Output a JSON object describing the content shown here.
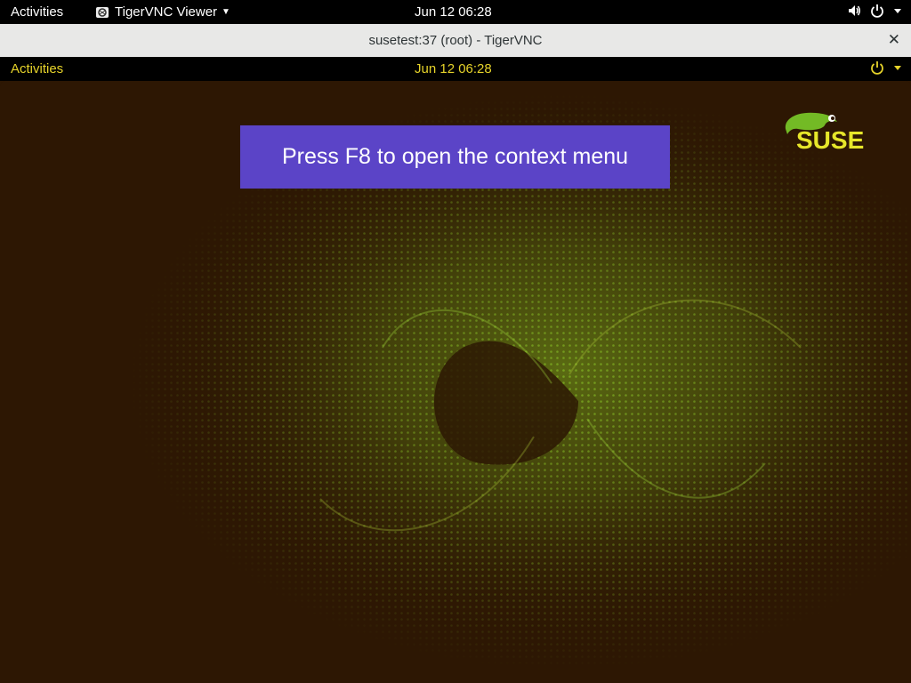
{
  "host_topbar": {
    "activities": "Activities",
    "app_menu_label": "TigerVNC Viewer",
    "clock": "Jun 12  06:28"
  },
  "window": {
    "title": "susetest:37 (root) - TigerVNC",
    "close_glyph": "✕"
  },
  "remote_topbar": {
    "activities": "Activities",
    "clock": "Jun 12  06:28"
  },
  "banner": {
    "text": "Press F8 to open the context menu"
  },
  "logo": {
    "text": "SUSE"
  },
  "icons": {
    "app": "tigervnc-icon",
    "volume": "volume-icon",
    "power": "power-icon",
    "dropdown": "chevron-down-icon"
  },
  "colors": {
    "host_bar": "#000000",
    "remote_accent": "#e6d32a",
    "desktop_bg": "#2d1703",
    "banner_bg": "#5b44c7",
    "suse_green": "#73ba25"
  }
}
